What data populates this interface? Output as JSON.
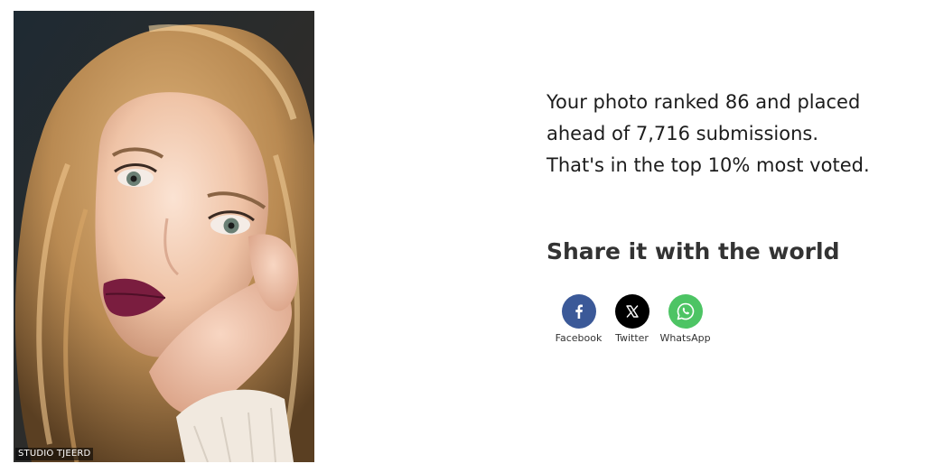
{
  "photo": {
    "alt": "Portrait of a young woman with long wavy blonde hair and dark plum lipstick, resting her face on her hands",
    "watermark": "STUDIO TJEERD"
  },
  "stats": {
    "line1": "Your photo ranked 86 and placed",
    "line2": "ahead of 7,716 submissions.",
    "line3": "That's in the top 10% most voted."
  },
  "share": {
    "heading": "Share it with the world",
    "buttons": [
      {
        "label": "Facebook",
        "icon": "facebook-icon",
        "color": "#3b5998"
      },
      {
        "label": "Twitter",
        "icon": "x-icon",
        "color": "#000000"
      },
      {
        "label": "WhatsApp",
        "icon": "whatsapp-icon",
        "color": "#4dc464"
      }
    ]
  }
}
